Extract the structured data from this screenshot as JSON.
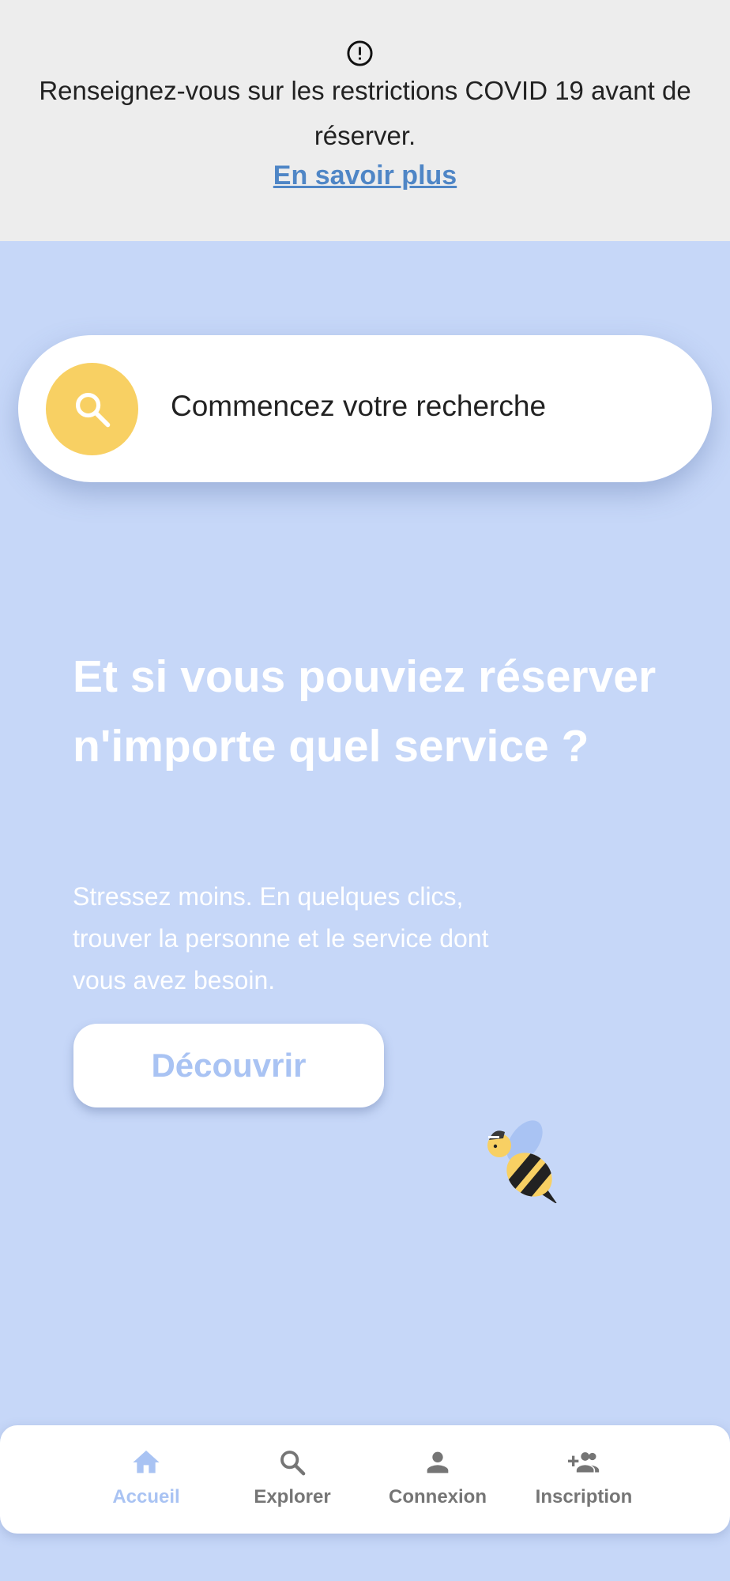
{
  "covid_banner": {
    "icon": "alert-circle-icon",
    "message": "Renseignez-vous sur les restrictions COVID 19 avant de réserver.",
    "link_label": "En savoir plus"
  },
  "search": {
    "icon": "search-icon",
    "placeholder": "Commencez votre recherche"
  },
  "hero": {
    "title": "Et si vous pouviez réserver n'importe quel service ?",
    "subtitle": "Stressez moins. En quelques clics, trouver la personne et le service dont vous avez besoin.",
    "cta_label": "Découvrir",
    "illustration": "bee-illustration"
  },
  "bottom_nav": {
    "items": [
      {
        "label": "Accueil",
        "icon": "home-icon",
        "active": true
      },
      {
        "label": "Explorer",
        "icon": "search-icon",
        "active": false
      },
      {
        "label": "Connexion",
        "icon": "person-icon",
        "active": false
      },
      {
        "label": "Inscription",
        "icon": "person-add-icon",
        "active": false
      }
    ]
  },
  "colors": {
    "page_background": "#c6d7f8",
    "banner_background": "#ededed",
    "link": "#4f86c6",
    "search_accent": "#f8d063",
    "primary_light": "#a9c3f3",
    "nav_inactive": "#757575"
  }
}
